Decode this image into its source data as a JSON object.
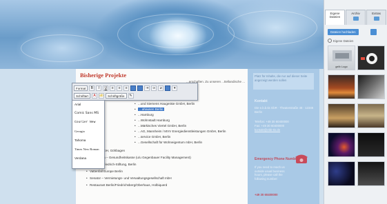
{
  "page": {
    "heading": "Bisherige Projekte",
    "intro_text": "...erschaften. Zu unseren ...ttellandische ..."
  },
  "toolbar": {
    "format_label": "Format",
    "font_label": "Schriftart",
    "size_label": "Schriftgröße"
  },
  "font_menu": {
    "options": [
      "Arial",
      "Comic Sans MS",
      "Courier New",
      "Georgia",
      "Tahoma",
      "Times New Roman",
      "Verdana"
    ]
  },
  "projects": [
    "...und Siemens Haugeräte GmbH, Berlin",
    "...ahausen Berlin",
    "...Hamburg",
    "...Wohnstadt Hamburg",
    "...Märkisches Viertel GmbH, Berlin",
    "...AG, Mannheim / MVV Energiedienstleistungen GmbH, Berlin",
    "...service GmbH, Berlin",
    "...Gesellschaft für Wohneigentum mbH, Berlin",
    "ELCO GmbH, Göhbagen",
    "AOK Berlin – Gesundheitskasse (u/u Gegenbauer Facility Management)",
    "Kaiserin-Friedrich-Stiftung, Berlin",
    "Vattenfall Europe Berlin",
    "Senator – Vermietungs- und Verwaltungsgesellschaft mbH",
    "Restaurant Berlin/Friedrichsberg/Oberhaus, Holbiquerd"
  ],
  "info": {
    "note": "Platz für Inhalte, die nur auf dieser Seite angezeigt werden sollen",
    "kontakt_heading": "Kontakt",
    "address": "Die e.b.b.tis GbR · Theaterstraße 48 · 12345 Berlin",
    "phone": "Telefon: +49 30 60400000",
    "fax": "Fax: +49 30 60400000",
    "email": "kontakt@ebb-tis.de",
    "emergency_heading": "Emergency Phone Number",
    "emergency_text": "If you need to reach us outside usual business hours, please call the following number:",
    "emergency_number": "+49 30 60400000"
  },
  "panel": {
    "tabs": [
      "Eigene Dateien",
      "Archiv",
      "Extras"
    ],
    "upload_label": "Dateien hochladen",
    "radio_label": "Eigene Dateien",
    "thumb_caption": "gelb Logo"
  },
  "colors": {
    "heading": "#c0392b",
    "selection": "#3d78c8",
    "info_column": "#a9c9e6",
    "panel_accent": "#4a8ed4"
  }
}
